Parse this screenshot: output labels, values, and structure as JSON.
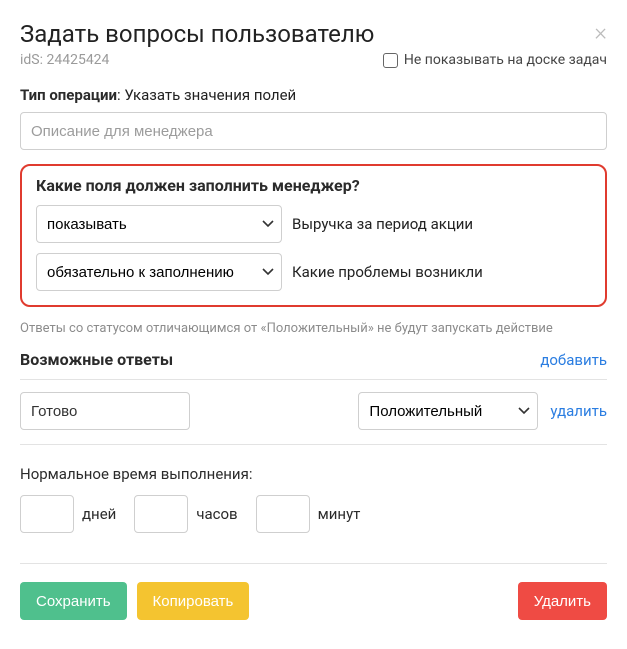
{
  "header": {
    "title": "Задать вопросы пользователю",
    "ids_label": "idS: 24425424",
    "checkbox_label": "Не показывать на доске задач"
  },
  "operation": {
    "label_bold": "Тип операции",
    "label_rest": ": Указать значения полей",
    "placeholder": "Описание для менеджера"
  },
  "fields_section": {
    "title": "Какие поля должен заполнить менеджер?",
    "rows": [
      {
        "select": "показывать",
        "text": "Выручка за период акции"
      },
      {
        "select": "обязательно к заполнению",
        "text": "Какие проблемы возникли"
      }
    ]
  },
  "hint": "Ответы со статусом отличающимся от «Положительный» не будут запускать действие",
  "answers": {
    "title": "Возможные ответы",
    "add": "добавить",
    "rows": [
      {
        "value": "Готово",
        "status": "Положительный",
        "del": "удалить"
      }
    ]
  },
  "exec_time": {
    "label": "Нормальное время выполнения:",
    "units": {
      "days": "дней",
      "hours": "часов",
      "minutes": "минут"
    }
  },
  "footer": {
    "save": "Сохранить",
    "copy": "Копировать",
    "delete": "Удалить"
  }
}
